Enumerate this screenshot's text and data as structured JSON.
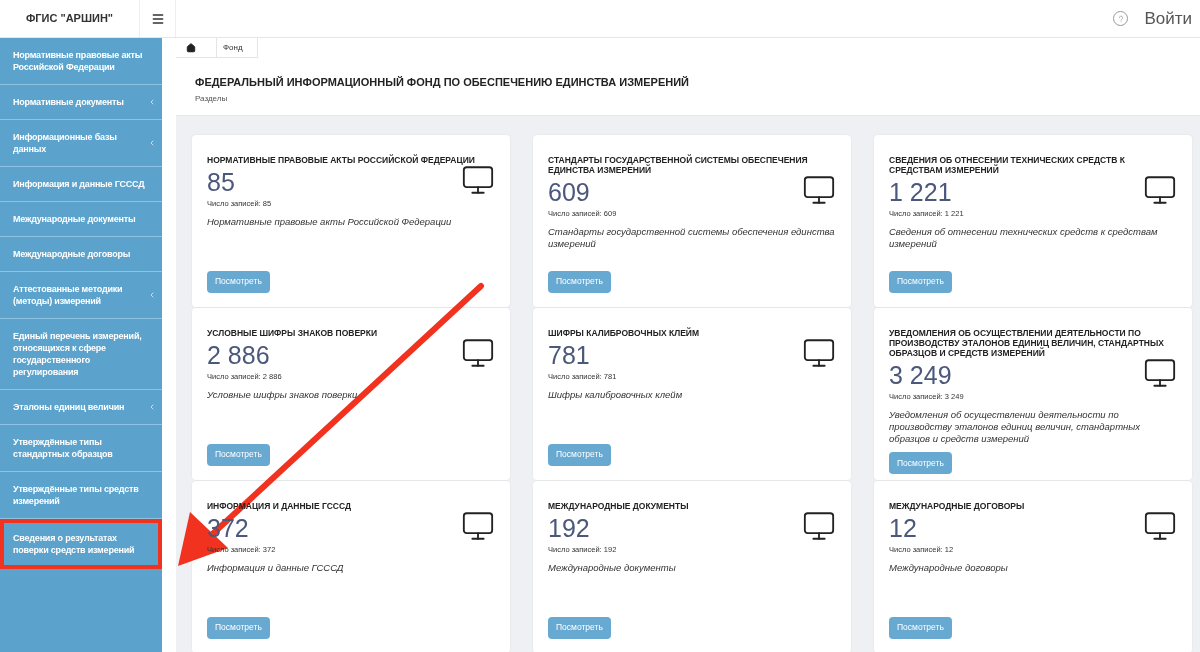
{
  "brand": "ФГИС \"АРШИН\"",
  "header": {
    "login": "Войти"
  },
  "sidebar": {
    "items": [
      {
        "label": "Нормативные правовые акты Российской Федерации",
        "expandable": false,
        "highlighted": false
      },
      {
        "label": "Нормативные документы",
        "expandable": true,
        "highlighted": false
      },
      {
        "label": "Информационные базы данных",
        "expandable": true,
        "highlighted": false
      },
      {
        "label": "Информация и данные ГСССД",
        "expandable": false,
        "highlighted": false
      },
      {
        "label": "Международные документы",
        "expandable": false,
        "highlighted": false
      },
      {
        "label": "Международные договоры",
        "expandable": false,
        "highlighted": false
      },
      {
        "label": "Аттестованные методики (методы) измерений",
        "expandable": true,
        "highlighted": false
      },
      {
        "label": "Единый перечень измерений, относящихся к сфере государственного регулирования",
        "expandable": false,
        "highlighted": false
      },
      {
        "label": "Эталоны единиц величин",
        "expandable": true,
        "highlighted": false
      },
      {
        "label": "Утверждённые типы стандартных образцов",
        "expandable": false,
        "highlighted": false
      },
      {
        "label": "Утверждённые типы средств измерений",
        "expandable": false,
        "highlighted": false
      },
      {
        "label": "Сведения о результатах поверки средств измерений",
        "expandable": false,
        "highlighted": true
      }
    ]
  },
  "breadcrumb": [
    "Фонд"
  ],
  "page": {
    "title": "ФЕДЕРАЛЬНЫЙ ИНФОРМАЦИОННЫЙ ФОНД ПО ОБЕСПЕЧЕНИЮ ЕДИНСТВА ИЗМЕРЕНИЙ",
    "subtitle": "Разделы"
  },
  "cards": [
    {
      "title": "НОРМАТИВНЫЕ ПРАВОВЫЕ АКТЫ РОССИЙСКОЙ ФЕДЕРАЦИИ",
      "count": "85",
      "records": "Число записей: 85",
      "description": "Нормативные правовые акты Российской Федерации",
      "button": "Посмотреть"
    },
    {
      "title": "СТАНДАРТЫ ГОСУДАРСТВЕННОЙ СИСТЕМЫ ОБЕСПЕЧЕНИЯ ЕДИНСТВА ИЗМЕРЕНИЙ",
      "count": "609",
      "records": "Число записей: 609",
      "description": "Стандарты государственной системы обеспечения единства измерений",
      "button": "Посмотреть"
    },
    {
      "title": "СВЕДЕНИЯ ОБ ОТНЕСЕНИИ ТЕХНИЧЕСКИХ СРЕДСТВ К СРЕДСТВАМ ИЗМЕРЕНИЙ",
      "count": "1 221",
      "records": "Число записей: 1 221",
      "description": "Сведения об отнесении технических средств к средствам измерений",
      "button": "Посмотреть"
    },
    {
      "title": "УСЛОВНЫЕ ШИФРЫ ЗНАКОВ ПОВЕРКИ",
      "count": "2 886",
      "records": "Число записей: 2 886",
      "description": "Условные шифры знаков поверки",
      "button": "Посмотреть"
    },
    {
      "title": "ШИФРЫ КАЛИБРОВОЧНЫХ КЛЕЙМ",
      "count": "781",
      "records": "Число записей: 781",
      "description": "Шифры калибровочных клейм",
      "button": "Посмотреть"
    },
    {
      "title": "УВЕДОМЛЕНИЯ ОБ ОСУЩЕСТВЛЕНИИ ДЕЯТЕЛЬНОСТИ ПО ПРОИЗВОДСТВУ ЭТАЛОНОВ ЕДИНИЦ ВЕЛИЧИН, СТАНДАРТНЫХ ОБРАЗЦОВ И СРЕДСТВ ИЗМЕРЕНИЙ",
      "count": "3 249",
      "records": "Число записей: 3 249",
      "description": "Уведомления об осуществлении деятельности по производству эталонов единиц величин, стандартных образцов и средств измерений",
      "button": "Посмотреть"
    },
    {
      "title": "ИНФОРМАЦИЯ И ДАННЫЕ ГСССД",
      "count": "372",
      "records": "Число записей: 372",
      "description": "Информация и данные ГСССД",
      "button": "Посмотреть"
    },
    {
      "title": "МЕЖДУНАРОДНЫЕ ДОКУМЕНТЫ",
      "count": "192",
      "records": "Число записей: 192",
      "description": "Международные документы",
      "button": "Посмотреть"
    },
    {
      "title": "МЕЖДУНАРОДНЫЕ ДОГОВОРЫ",
      "count": "12",
      "records": "Число записей: 12",
      "description": "Международные договоры",
      "button": "Посмотреть"
    }
  ]
}
